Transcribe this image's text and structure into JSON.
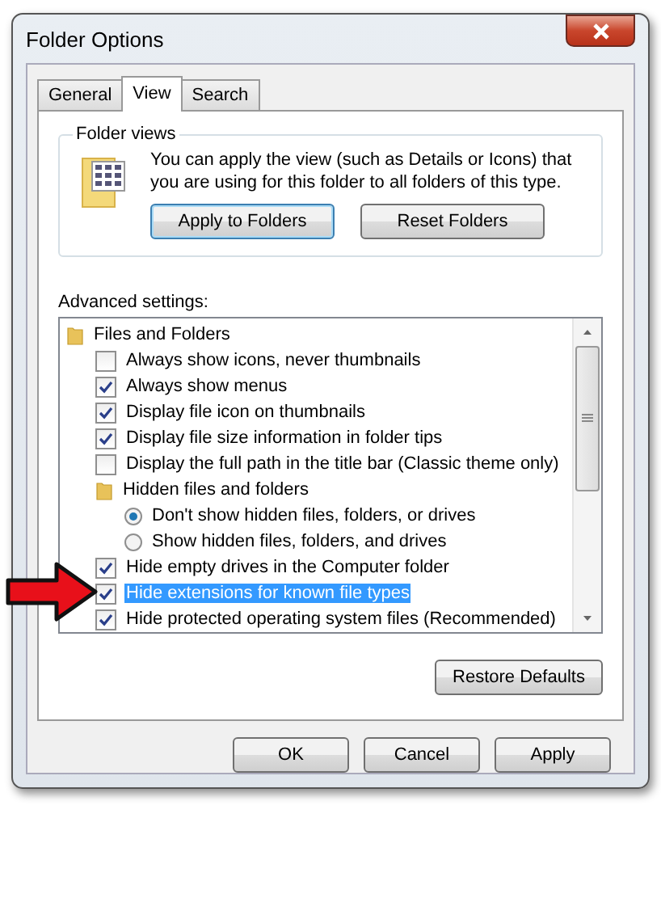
{
  "window": {
    "title": "Folder Options"
  },
  "tabs": [
    {
      "label": "General",
      "selected": false
    },
    {
      "label": "View",
      "selected": true
    },
    {
      "label": "Search",
      "selected": false
    }
  ],
  "folder_views": {
    "title": "Folder views",
    "text": "You can apply the view (such as Details or Icons) that you are using for this folder to all folders of this type.",
    "buttons": [
      {
        "label": "Apply to Folders",
        "selected": true
      },
      {
        "label": "Reset Folders",
        "selected": false
      }
    ]
  },
  "advanced": {
    "label": "Advanced settings:",
    "items": [
      {
        "kind": "folder",
        "label": "Files and Folders",
        "selected": false,
        "children": [
          {
            "kind": "checkbox",
            "label": "Always show icons, never thumbnails",
            "checked": false,
            "selected": false
          },
          {
            "kind": "checkbox",
            "label": "Always show menus",
            "checked": true,
            "selected": false
          },
          {
            "kind": "checkbox",
            "label": "Display file icon on thumbnails",
            "checked": true,
            "selected": false
          },
          {
            "kind": "checkbox",
            "label": "Display file size information in folder tips",
            "checked": true,
            "selected": false
          },
          {
            "kind": "checkbox",
            "label": "Display the full path in the title bar (Classic theme only)",
            "checked": false,
            "selected": false
          },
          {
            "kind": "folder",
            "label": "Hidden files and folders",
            "selected": false,
            "children": [
              {
                "kind": "radio",
                "label": "Don't show hidden files, folders, or drives",
                "checked": true,
                "selected": false
              },
              {
                "kind": "radio",
                "label": "Show hidden files, folders, and drives",
                "checked": false,
                "selected": false
              }
            ]
          },
          {
            "kind": "checkbox",
            "label": "Hide empty drives in the Computer folder",
            "checked": true,
            "selected": false
          },
          {
            "kind": "checkbox",
            "label": "Hide extensions for known file types",
            "checked": true,
            "selected": true
          },
          {
            "kind": "checkbox",
            "label": "Hide protected operating system files (Recommended)",
            "checked": true,
            "selected": false
          }
        ]
      }
    ]
  },
  "restore_button": "Restore Defaults",
  "buttons": [
    "OK",
    "Cancel",
    "Apply"
  ]
}
